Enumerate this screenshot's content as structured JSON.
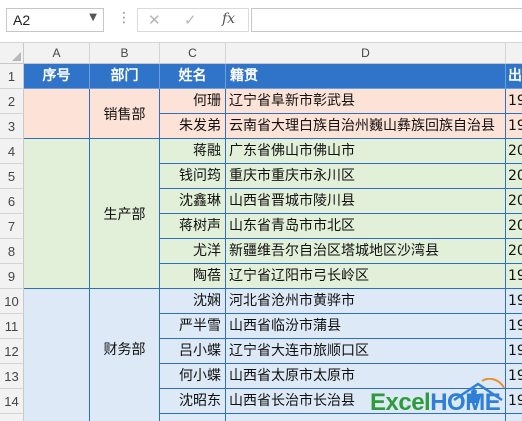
{
  "formula_bar": {
    "name_box": "A2",
    "cancel_icon": "✕",
    "enter_icon": "✓",
    "function_icon": "fx",
    "formula": ""
  },
  "columns": [
    "A",
    "B",
    "C",
    "D"
  ],
  "rows": [
    "1",
    "2",
    "3",
    "4",
    "5",
    "6",
    "7",
    "8",
    "9",
    "10",
    "11",
    "12",
    "13",
    "14"
  ],
  "header": {
    "seq": "序号",
    "dept": "部门",
    "name": "姓名",
    "native": "籍贯",
    "partial": "出"
  },
  "groups": {
    "sales": "销售部",
    "production": "生产部",
    "finance": "财务部"
  },
  "records": [
    {
      "name": "何珊",
      "native": "辽宁省阜新市彰武县",
      "e": "19"
    },
    {
      "name": "朱发弟",
      "native": "云南省大理白族自治州巍山彝族回族自治县",
      "e": "19"
    },
    {
      "name": "蒋融",
      "native": "广东省佛山市佛山市",
      "e": "20"
    },
    {
      "name": "钱问筠",
      "native": "重庆市重庆市永川区",
      "e": "20"
    },
    {
      "name": "沈鑫琳",
      "native": "山西省晋城市陵川县",
      "e": "20"
    },
    {
      "name": "蒋树声",
      "native": "山东省青岛市市北区",
      "e": "20"
    },
    {
      "name": "尤洋",
      "native": "新疆维吾尔自治区塔城地区沙湾县",
      "e": "20"
    },
    {
      "name": "陶蓓",
      "native": "辽宁省辽阳市弓长岭区",
      "e": "19"
    },
    {
      "name": "沈娴",
      "native": "河北省沧州市黄骅市",
      "e": "19"
    },
    {
      "name": "严半雪",
      "native": "山西省临汾市蒲县",
      "e": "19"
    },
    {
      "name": "吕小蝶",
      "native": "辽宁省大连市旅顺口区",
      "e": "19"
    },
    {
      "name": "何小蝶",
      "native": "山西省太原市太原市",
      "e": "19"
    },
    {
      "name": "沈昭东",
      "native": "山西省长治市长治县",
      "e": "19"
    }
  ],
  "colors": {
    "header_fill": "#2f74c8",
    "sales_fill": "#fde3d7",
    "production_fill": "#e3f0d9",
    "finance_fill": "#dde9f6",
    "border": "#2f6fbf"
  },
  "watermark": {
    "excel": "Excel",
    "home": "HOME"
  }
}
